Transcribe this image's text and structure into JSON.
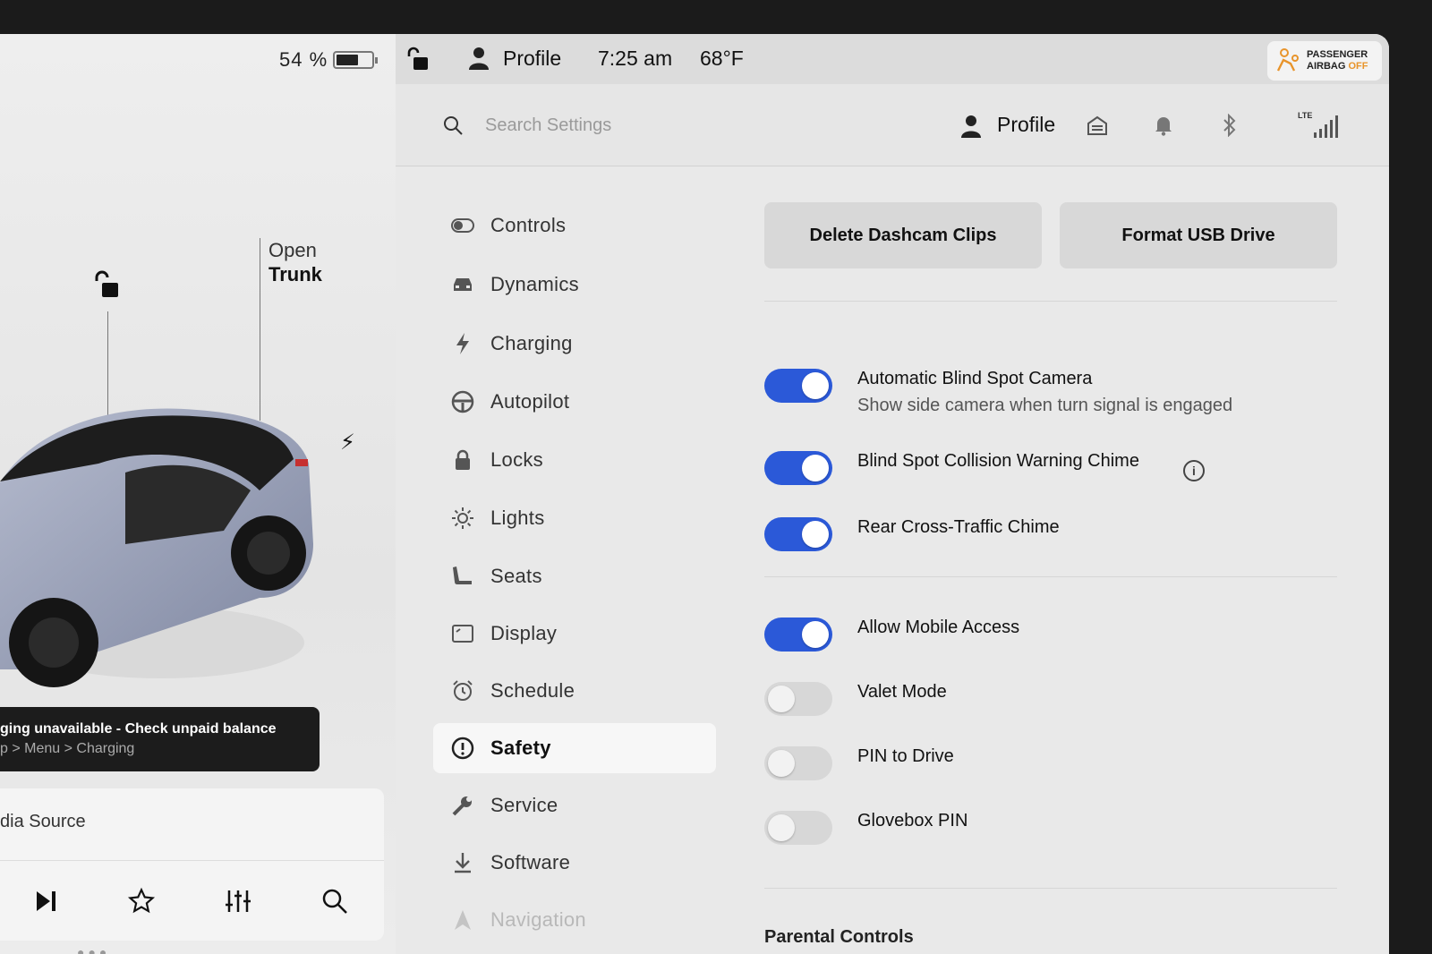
{
  "status": {
    "battery_percent": "54 %",
    "battery_level": 0.54,
    "profile": "Profile",
    "time": "7:25 am",
    "temperature": "68°F",
    "airbag_line1": "PASSENGER",
    "airbag_line2": "AIRBAG",
    "airbag_state": "OFF"
  },
  "car": {
    "open_label": "Open",
    "trunk_label": "Trunk",
    "alert_line1": "ging unavailable - Check unpaid balance",
    "alert_line2": "p > Menu > Charging",
    "media_source": "dia Source"
  },
  "header": {
    "search_placeholder": "Search Settings",
    "profile": "Profile",
    "signal_label": "LTE"
  },
  "sidebar": {
    "items": [
      {
        "label": "Controls",
        "icon": "toggle-icon"
      },
      {
        "label": "Dynamics",
        "icon": "car-icon"
      },
      {
        "label": "Charging",
        "icon": "bolt-icon"
      },
      {
        "label": "Autopilot",
        "icon": "steering-wheel-icon"
      },
      {
        "label": "Locks",
        "icon": "lock-icon"
      },
      {
        "label": "Lights",
        "icon": "sun-icon"
      },
      {
        "label": "Seats",
        "icon": "seat-icon"
      },
      {
        "label": "Display",
        "icon": "display-icon"
      },
      {
        "label": "Schedule",
        "icon": "alarm-clock-icon"
      },
      {
        "label": "Safety",
        "icon": "alert-circle-icon",
        "active": true
      },
      {
        "label": "Service",
        "icon": "wrench-icon"
      },
      {
        "label": "Software",
        "icon": "download-icon"
      },
      {
        "label": "Navigation",
        "icon": "navigation-icon"
      }
    ]
  },
  "main": {
    "delete_dashcam": "Delete Dashcam Clips",
    "format_usb": "Format USB Drive",
    "settings": [
      {
        "title": "Automatic Blind Spot Camera",
        "subtitle": "Show side camera when turn signal is engaged",
        "on": true
      },
      {
        "title": "Blind Spot Collision Warning Chime",
        "on": true
      },
      {
        "title": "Rear Cross-Traffic Chime",
        "on": true
      },
      {
        "title": "Allow Mobile Access",
        "on": true
      },
      {
        "title": "Valet Mode",
        "on": false
      },
      {
        "title": "PIN to Drive",
        "on": false
      },
      {
        "title": "Glovebox PIN",
        "on": false
      }
    ],
    "parental_title": "Parental Controls"
  },
  "colors": {
    "accent": "#2b59d8",
    "airbag_off": "#e8942b"
  }
}
